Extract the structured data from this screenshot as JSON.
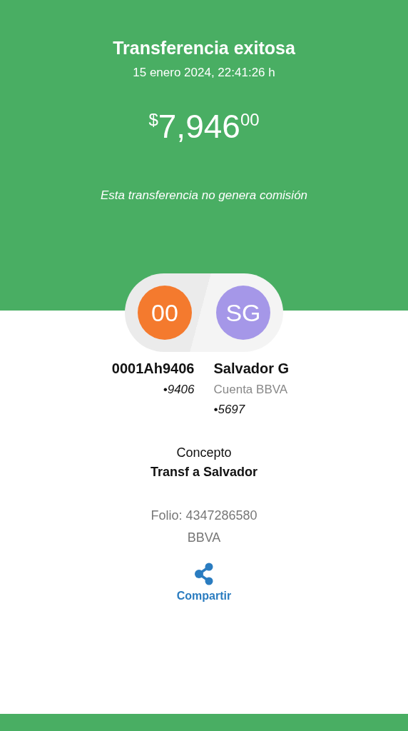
{
  "header": {
    "title": "Transferencia exitosa",
    "date": "15 enero 2024, 22:41:26 h",
    "amount": {
      "currency": "$",
      "integer": "7,946",
      "cents": "00"
    },
    "note": "Esta transferencia no genera comisión"
  },
  "parties": [
    {
      "initials": "00",
      "color": "#f47a2e",
      "name": "0001Ah9406",
      "account": "•9406"
    },
    {
      "initials": "SG",
      "color": "#a597e8",
      "name": "Salvador G",
      "bank": "Cuenta BBVA",
      "account": "•5697"
    }
  ],
  "concept": {
    "label": "Concepto",
    "value": "Transf a Salvador"
  },
  "folio": "Folio: 4347286580",
  "bank": "BBVA",
  "share": {
    "label": "Compartir"
  }
}
